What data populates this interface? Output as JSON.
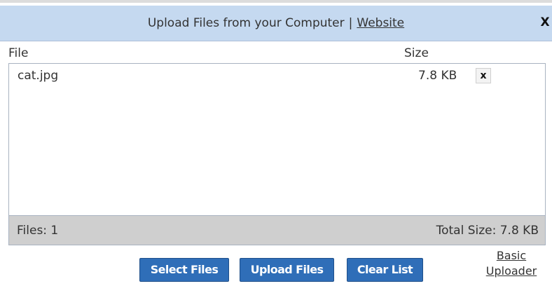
{
  "header": {
    "title": "Upload Files from your Computer",
    "separator": "|",
    "website_link": "Website",
    "close_label": "X"
  },
  "columns": {
    "file": "File",
    "size": "Size"
  },
  "files": [
    {
      "name": "cat.jpg",
      "size": "7.8 KB",
      "remove_label": "x"
    }
  ],
  "footer": {
    "count": "Files: 1",
    "total": "Total Size: 7.8 KB"
  },
  "buttons": {
    "select": "Select Files",
    "upload": "Upload Files",
    "clear": "Clear List"
  },
  "basic_uploader": {
    "line1": "Basic",
    "line2": "Uploader"
  },
  "colors": {
    "title_bar": "#c5d9f0",
    "button": "#2f6eb8",
    "footer_bar": "#cfcfcf"
  }
}
